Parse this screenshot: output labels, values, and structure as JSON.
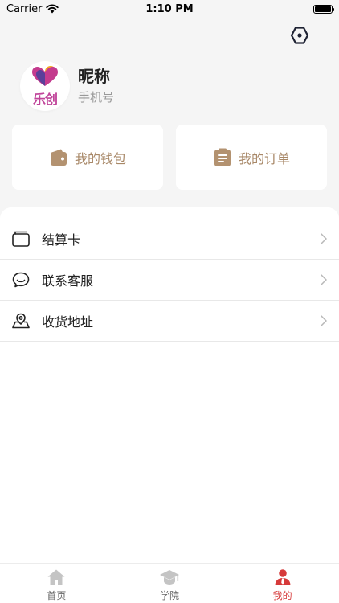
{
  "status_bar": {
    "carrier": "Carrier",
    "time": "1:10 PM"
  },
  "profile": {
    "nickname": "昵称",
    "phone_placeholder": "手机号",
    "logo_text": "乐创"
  },
  "cards": [
    {
      "label": "我的钱包",
      "icon": "wallet-icon"
    },
    {
      "label": "我的订单",
      "icon": "order-list-icon"
    }
  ],
  "menu": [
    {
      "label": "结算卡",
      "icon": "card-icon"
    },
    {
      "label": "联系客服",
      "icon": "chat-icon"
    },
    {
      "label": "收货地址",
      "icon": "location-icon"
    }
  ],
  "tabs": [
    {
      "label": "首页",
      "icon": "home-icon",
      "active": false
    },
    {
      "label": "学院",
      "icon": "graduation-cap-icon",
      "active": false
    },
    {
      "label": "我的",
      "icon": "user-icon",
      "active": true
    }
  ],
  "colors": {
    "accent": "#d63a3a",
    "card_text": "#a88868",
    "card_icon": "#b39270",
    "tab_inactive": "#c4c4c4"
  }
}
